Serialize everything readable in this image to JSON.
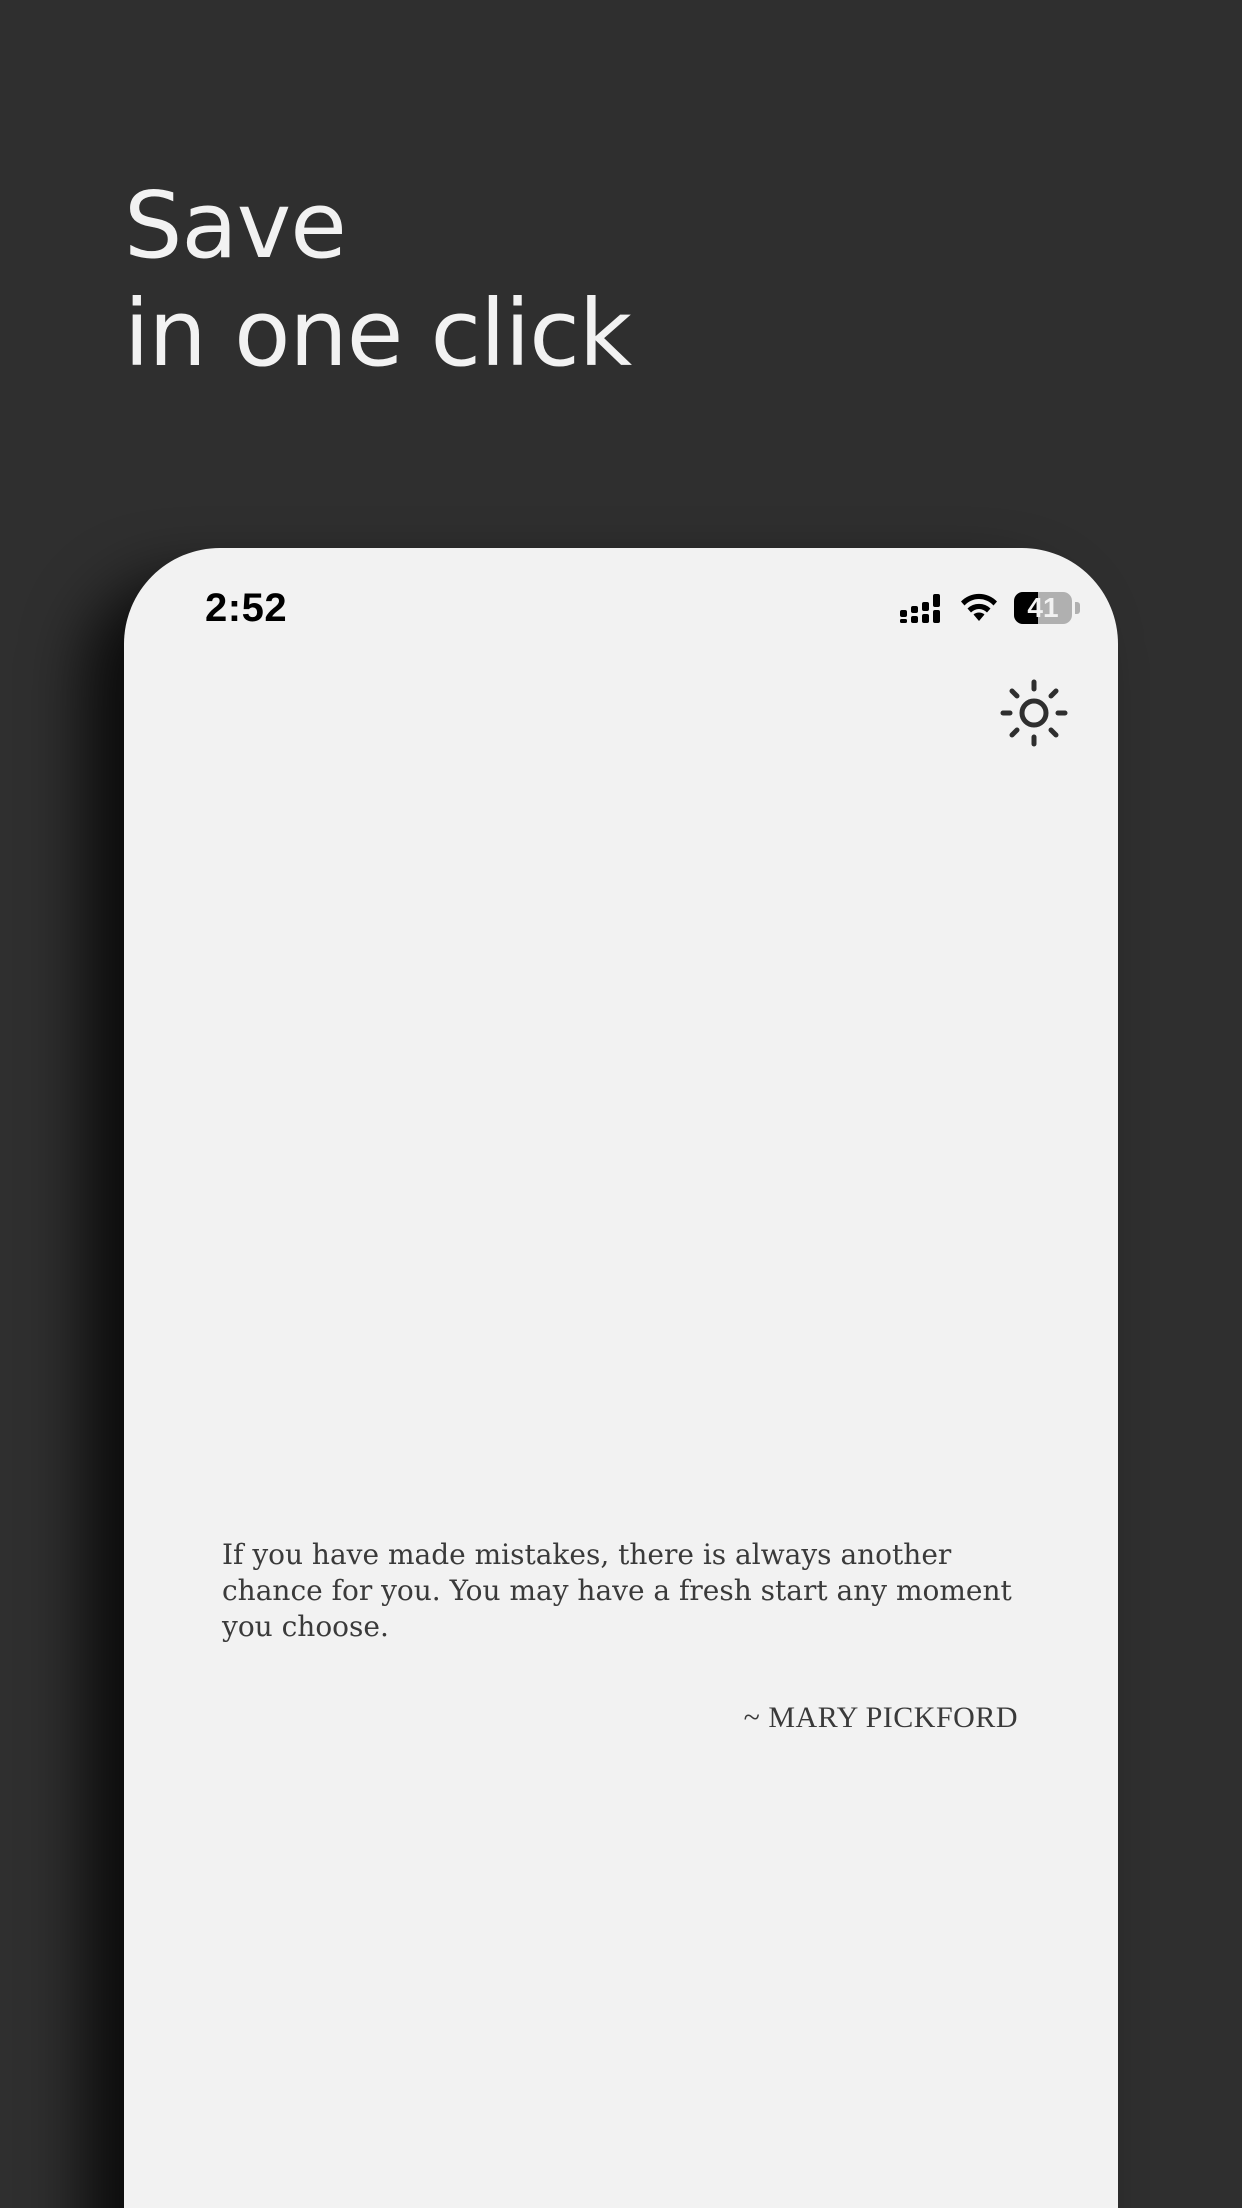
{
  "headline": {
    "line1": "Save",
    "line2": "in one click"
  },
  "status_bar": {
    "time": "2:52",
    "battery_level": "41",
    "battery_fraction": 0.41,
    "icons": [
      "cellular-signal-icon",
      "wifi-icon",
      "battery-icon"
    ]
  },
  "toolbar": {
    "theme_icon": "sun-icon"
  },
  "quote": {
    "text": "If you have made mistakes, there is always another chance for you. You may have a fresh start any moment you choose.",
    "author": "~ MARY PICKFORD"
  },
  "colors": {
    "background": "#2f2f2f",
    "screen": "#f2f2f2",
    "headline": "#f2f2f2",
    "text": "#3a3a3a"
  }
}
